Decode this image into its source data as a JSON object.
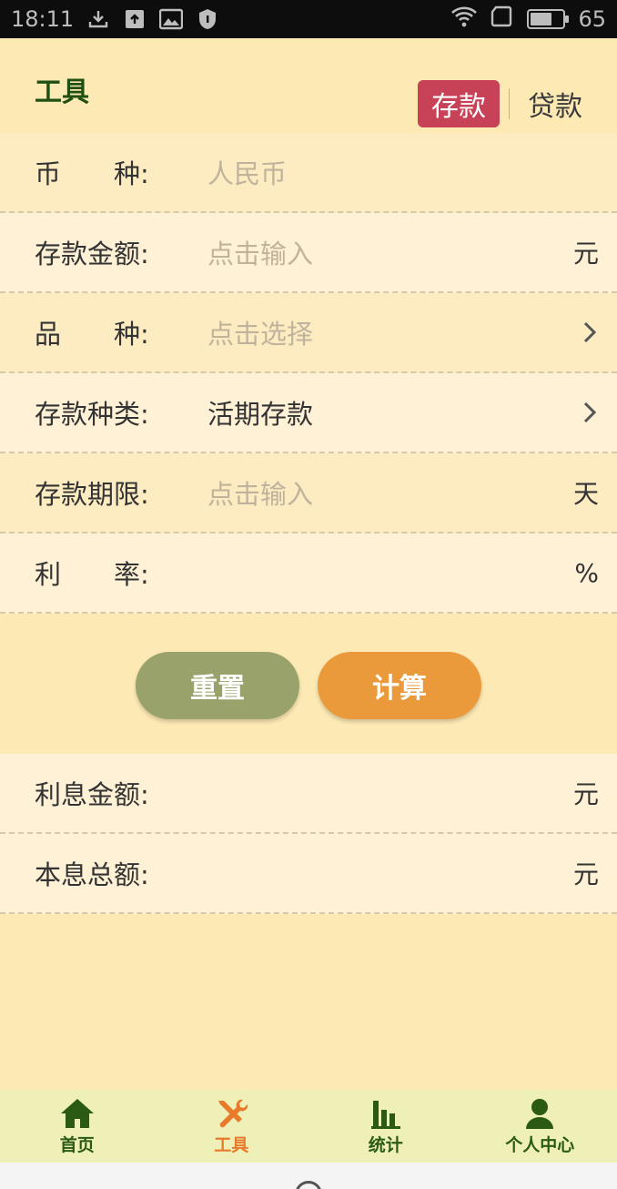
{
  "status_bar": {
    "time": "18:11",
    "battery": "65"
  },
  "header": {
    "title": "工具",
    "tabs": [
      "存款",
      "贷款"
    ],
    "active_tab": 0
  },
  "form": {
    "currency": {
      "label": "币　　种:",
      "placeholder": "人民币"
    },
    "amount": {
      "label": "存款金额:",
      "placeholder": "点击输入",
      "unit": "元"
    },
    "product": {
      "label": "品　　种:",
      "placeholder": "点击选择"
    },
    "deposit_type": {
      "label": "存款种类:",
      "value": "活期存款"
    },
    "term": {
      "label": "存款期限:",
      "placeholder": "点击输入",
      "unit": "天"
    },
    "rate": {
      "label": "利　　率:",
      "unit": "%"
    }
  },
  "buttons": {
    "reset": "重置",
    "calculate": "计算"
  },
  "results": {
    "interest": {
      "label": "利息金额:",
      "unit": "元"
    },
    "total": {
      "label": "本息总额:",
      "unit": "元"
    }
  },
  "bottom_nav": [
    {
      "label": "首页",
      "icon": "home-icon"
    },
    {
      "label": "工具",
      "icon": "tools-icon"
    },
    {
      "label": "统计",
      "icon": "stats-icon"
    },
    {
      "label": "个人中心",
      "icon": "person-icon"
    }
  ],
  "colors": {
    "accent": "#c84257",
    "dark_green": "#1f4f12",
    "orange": "#ea9a3a",
    "olive": "#98a26a"
  }
}
